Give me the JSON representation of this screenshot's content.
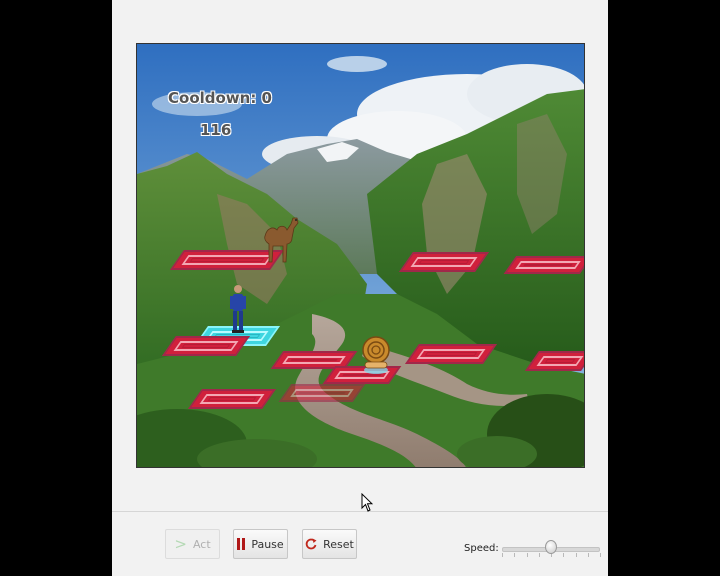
{
  "hud": {
    "cooldown": "Cooldown: 0",
    "score": "116"
  },
  "toolbar": {
    "act_label": "Act",
    "act_icon": "play-arrow-icon",
    "act_enabled": false,
    "pause_label": "Pause",
    "pause_icon": "pause-icon",
    "reset_label": "Reset",
    "reset_icon": "reset-icon"
  },
  "speed": {
    "label": "Speed:",
    "value": 0.5
  },
  "sprites": {
    "camel": "camel-sprite",
    "player": "man-player-sprite",
    "snail": "snail-sprite"
  },
  "colors": {
    "platform_red": "#d0203c",
    "platform_cyan": "#3fd6e0",
    "hud_text": "#555555",
    "window_bg": "#f2f2f2"
  }
}
